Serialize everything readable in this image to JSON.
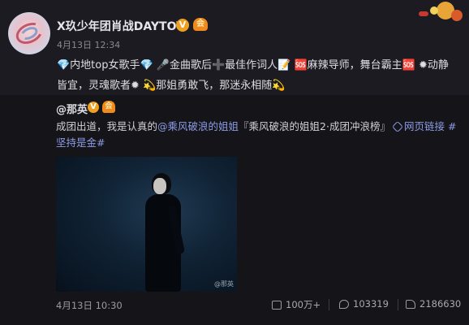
{
  "author": {
    "name": "X玖少年团肖战DAYTOY",
    "verified_mark": "V",
    "member_mark": "会",
    "timestamp": "4月13日 12:34",
    "avatar": "avatar-icon"
  },
  "post": {
    "text": "💎内地top女歌手💎 🎤金曲歌后➕最佳作词人📝 🆘麻辣导师，舞台霸主🆘 ✹动静皆宜，灵魂歌者✹ 💫那姐勇敢飞，那迷永相随💫"
  },
  "repost": {
    "name": "@那英",
    "verified_mark": "V",
    "member_mark": "会",
    "text_prefix": "成团出道，我是认真的",
    "mention": "@乘风破浪的姐姐",
    "text_mid": "『乘风破浪的姐姐2·成团冲浪榜』",
    "link_label": "网页链接",
    "hashtag": "#坚持是金#",
    "image": {
      "watermark": "@那英"
    },
    "footer": {
      "time": "4月13日 10:30",
      "reposts": "100万+",
      "comments": "103319",
      "likes": "2186630"
    }
  },
  "colors": {
    "background": "#1b1b21",
    "repost_background": "#141419",
    "link": "#8c9be6",
    "badge": "#f0a020"
  }
}
